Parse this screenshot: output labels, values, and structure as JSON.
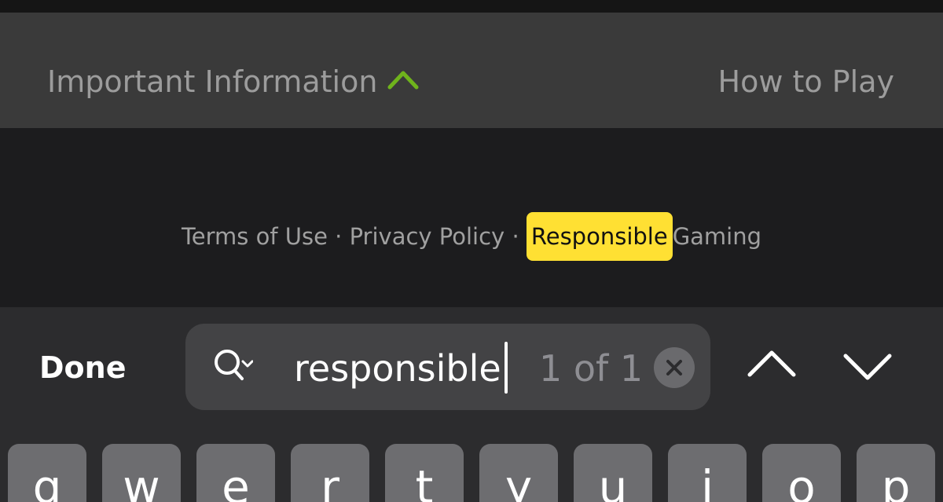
{
  "info_bar": {
    "title": "Important Information",
    "chevron_icon": "chevron-up-icon",
    "chevron_color": "#6fb31c",
    "how_to_play": "How to Play"
  },
  "footer": {
    "terms": "Terms of Use",
    "separator": "·",
    "privacy": "Privacy Policy",
    "responsible": "Responsible",
    "gaming": "Gaming",
    "highlight_color": "#ffe033"
  },
  "find_bar": {
    "done_label": "Done",
    "search_icon": "magnifier-dropdown-icon",
    "query": "responsible",
    "match_count": "1 of 1",
    "clear_icon": "clear-icon",
    "prev_icon": "chevron-up-icon",
    "next_icon": "chevron-down-icon"
  },
  "keyboard": {
    "keys": [
      "q",
      "w",
      "e",
      "r",
      "t",
      "y",
      "u",
      "i",
      "o",
      "p"
    ]
  }
}
